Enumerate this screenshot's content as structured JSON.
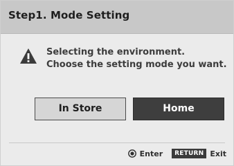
{
  "dialog": {
    "title": "Step1. Mode Setting",
    "icon": "warning-icon",
    "message_line1": "Selecting the environment.",
    "message_line2": "Choose the setting mode you want."
  },
  "buttons": {
    "in_store": "In Store",
    "home": "Home",
    "selected": "home"
  },
  "footer": {
    "enter_icon": "ok-button-icon",
    "enter_label": "Enter",
    "return_key": "RETURN",
    "exit_label": "Exit"
  },
  "colors": {
    "title_bar": "#c8c8c8",
    "body": "#ebebeb",
    "selected_button": "#3e3e3e",
    "unselected_button": "#d6d6d6"
  }
}
